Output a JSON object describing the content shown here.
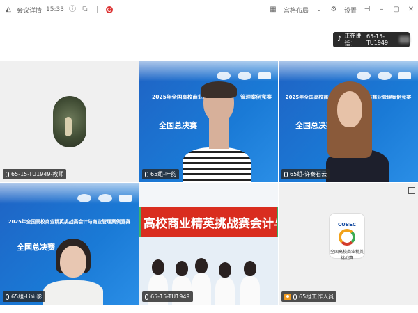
{
  "titlebar": {
    "app_label": "会议详情",
    "time": "15:33",
    "layout_label": "宫格布局",
    "settings_label": "设置"
  },
  "speaking": {
    "label": "正在讲话：",
    "name": "65-15-TU1949;"
  },
  "tiles": [
    {
      "name": "65-15-TU1949-教师"
    },
    {
      "name": "65组-叶韵"
    },
    {
      "name": "65组-许秦石云"
    },
    {
      "name": "65组-LiYu影"
    },
    {
      "name": "65-15-TU1949"
    },
    {
      "name": "65组工作人员"
    }
  ],
  "banner": {
    "title": "2025年全国高校商业精英挑战赛会计与商业管理案例竞赛",
    "subtitle": "全国总决赛",
    "title_t2_a": "2025年全国高校商业精英",
    "title_t2_b": "管理案例竞赛",
    "title_t3": "2025年全国高校商业精英挑战赛会计与商业管理案例竞赛"
  },
  "classroom": {
    "banner_text": "高校商业精英挑战赛会计与商业管理"
  },
  "cubec": {
    "name": "CUBEC",
    "cn": "全国高校商业精英挑战赛"
  },
  "colors": {
    "active_border": "#3bb36a",
    "banner_blue": "#1a7ad6",
    "red_banner": "#d92d1f",
    "record": "#dd3333"
  },
  "icons": {
    "record": "record-icon",
    "layout": "grid-layout-icon",
    "settings": "gear-icon",
    "minimize": "minimize-icon",
    "maximize": "maximize-icon",
    "close": "close-icon"
  }
}
